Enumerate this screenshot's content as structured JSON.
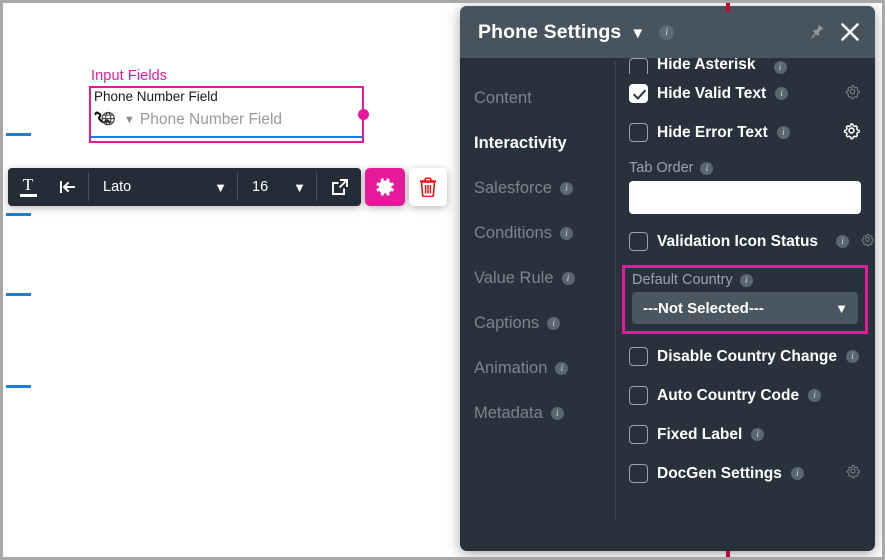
{
  "canvas": {
    "section_label": "Input Fields",
    "field_label": "Phone Number Field",
    "field_placeholder": "Phone Number Field",
    "selection_color": "#e6199b",
    "guide_color": "#1a80da",
    "underline_color": "#1a80da",
    "icons": {
      "phone_globe": "phone-globe-icon",
      "chevron": "chevron-down-icon"
    }
  },
  "toolbar": {
    "text_style_icon": "text-underline-icon",
    "indent_icon": "indent-left-icon",
    "font_family": "Lato",
    "font_size": "16",
    "open_external_icon": "external-link-icon",
    "settings_icon": "gear-icon",
    "delete_icon": "trash-icon",
    "accent_color": "#e6199b",
    "delete_color": "#e02020"
  },
  "panel": {
    "title": "Phone Settings",
    "title_chevron": "chevron-down-icon",
    "header_info_icon": "info-icon",
    "pin_icon": "pin-icon",
    "close_icon": "close-icon",
    "header_bg": "#47545e",
    "body_bg": "#27323c",
    "nav": [
      {
        "label": "Content",
        "active": false,
        "info": false
      },
      {
        "label": "Interactivity",
        "active": true,
        "info": false
      },
      {
        "label": "Salesforce",
        "active": false,
        "info": true
      },
      {
        "label": "Conditions",
        "active": false,
        "info": true
      },
      {
        "label": "Value Rule",
        "active": false,
        "info": true
      },
      {
        "label": "Captions",
        "active": false,
        "info": true
      },
      {
        "label": "Animation",
        "active": false,
        "info": true
      },
      {
        "label": "Metadata",
        "active": false,
        "info": true
      }
    ],
    "partial_row_label": "Hide Asterisk",
    "rows": [
      {
        "label": "Hide Valid Text",
        "checked": true,
        "info": true,
        "gear": true,
        "gear_dim": true
      },
      {
        "label": "Hide Error Text",
        "checked": false,
        "info": true,
        "gear": true,
        "gear_dim": false
      }
    ],
    "tab_order": {
      "label": "Tab Order",
      "info": true,
      "value": "",
      "placeholder": ""
    },
    "validation_row": {
      "label": "Validation Icon Status",
      "checked": false,
      "info": true,
      "gear": true
    },
    "default_country": {
      "label": "Default Country",
      "info": true,
      "selected": "---Not Selected---",
      "chevron": "chevron-down-icon",
      "highlight_color": "#e6199b"
    },
    "bottom_rows": [
      {
        "label": "Disable Country Change",
        "checked": false,
        "info": true,
        "gear": false
      },
      {
        "label": "Auto Country Code",
        "checked": false,
        "info": true,
        "gear": false
      },
      {
        "label": "Fixed Label",
        "checked": false,
        "info": true,
        "gear": false
      },
      {
        "label": "DocGen Settings",
        "checked": false,
        "info": true,
        "gear": true
      }
    ]
  }
}
